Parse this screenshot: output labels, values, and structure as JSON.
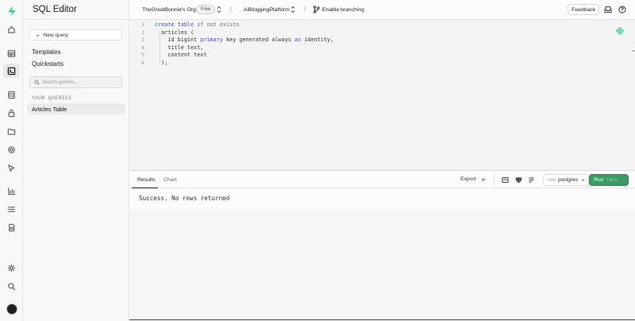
{
  "rail": {
    "items": [
      {
        "icon": "supabase-logo-icon",
        "active": false
      },
      {
        "icon": "home-icon",
        "active": false
      },
      {
        "icon": "table-editor-icon",
        "active": false
      },
      {
        "icon": "sql-editor-icon",
        "active": true
      },
      {
        "icon": "database-icon",
        "active": false
      },
      {
        "icon": "auth-lock-icon",
        "active": false
      },
      {
        "icon": "storage-icon",
        "active": false
      },
      {
        "icon": "edge-functions-icon",
        "active": false
      },
      {
        "icon": "realtime-icon",
        "active": false
      },
      {
        "icon": "reports-icon",
        "active": false
      },
      {
        "icon": "logs-icon",
        "active": false
      },
      {
        "icon": "docs-icon",
        "active": false
      },
      {
        "icon": "settings-gear-icon",
        "active": false
      },
      {
        "icon": "search-icon",
        "active": false
      },
      {
        "icon": "user-avatar-icon",
        "active": false
      }
    ]
  },
  "sidebar": {
    "title": "SQL Editor",
    "new_query_label": "New query",
    "links": [
      "Templates",
      "Quickstarts"
    ],
    "search_placeholder": "Search queries...",
    "section_label": "YOUR QUERIES",
    "queries": [
      "Articles Table"
    ]
  },
  "topbar": {
    "org_name": "TheGreatBonnie's Org",
    "plan_badge": "Free",
    "separator": "/",
    "project_name": "AiBloggingPlatform",
    "branching_label": "Enable branching",
    "feedback_label": "Feedback"
  },
  "editor": {
    "line_numbers": [
      "1",
      "2",
      "3",
      "4",
      "5",
      "6"
    ]
  },
  "results": {
    "tabs": [
      "Results",
      "Chart"
    ],
    "active_tab": "Results",
    "export_label": "Export",
    "role_prefix": "role",
    "role_value": "postgres",
    "run_label": "Run",
    "run_shortcut": "Ctrl ↵",
    "message": "Success. No rows returned"
  },
  "colors": {
    "brand": "#3ecf8e",
    "run_button": "#3a9c64",
    "keyword": "#3b51b8"
  }
}
